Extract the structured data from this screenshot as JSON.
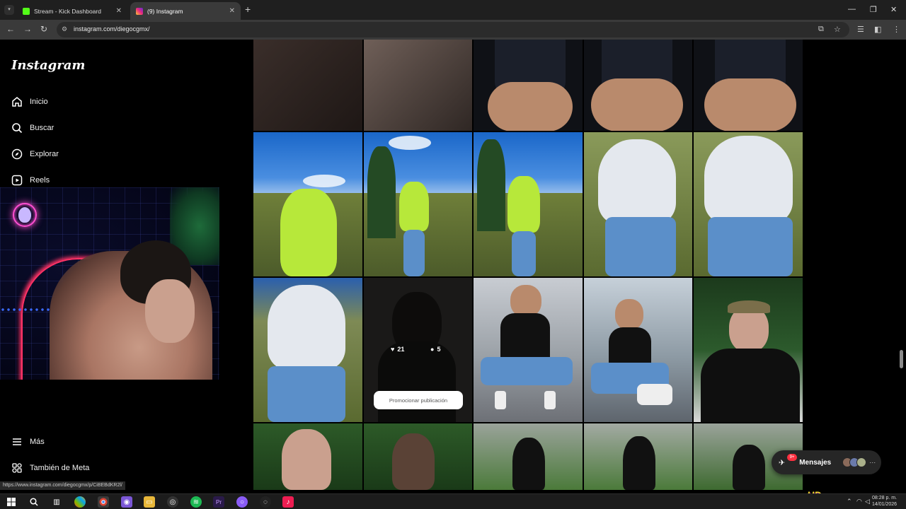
{
  "browser": {
    "tabs": [
      {
        "title": "Stream - Kick Dashboard",
        "favicon_color": "#53fc18"
      },
      {
        "title": "(9) Instagram",
        "favicon_color": "#e1306c",
        "active": true
      }
    ],
    "url": "instagram.com/diegocgmx/",
    "status_url": "https://www.instagram.com/diegocgmx/p/CiBEBdKR2l/"
  },
  "instagram": {
    "logo": "Instagram",
    "nav": [
      {
        "label": "Inicio",
        "icon": "home-icon"
      },
      {
        "label": "Buscar",
        "icon": "search-icon"
      },
      {
        "label": "Explorar",
        "icon": "compass-icon"
      },
      {
        "label": "Reels",
        "icon": "reels-icon"
      }
    ],
    "bottom_nav": [
      {
        "label": "Más",
        "icon": "menu-icon"
      },
      {
        "label": "También de Meta",
        "icon": "meta-icon"
      }
    ],
    "hover_post": {
      "likes": "21",
      "comments": "5",
      "promote_label": "Promocionar publicación"
    },
    "messages": {
      "label": "Mensajes",
      "badge": "9+"
    }
  },
  "stream_overlay": {
    "logo": "HD"
  },
  "taskbar": {
    "time": "08:28 p. m.",
    "date": "14/01/2026"
  },
  "colors": {
    "instagram_bg": "#000000",
    "chrome_active_tab": "#3a3a3a",
    "kick_green": "#53fc18",
    "instagram_pink": "#e1306c"
  }
}
